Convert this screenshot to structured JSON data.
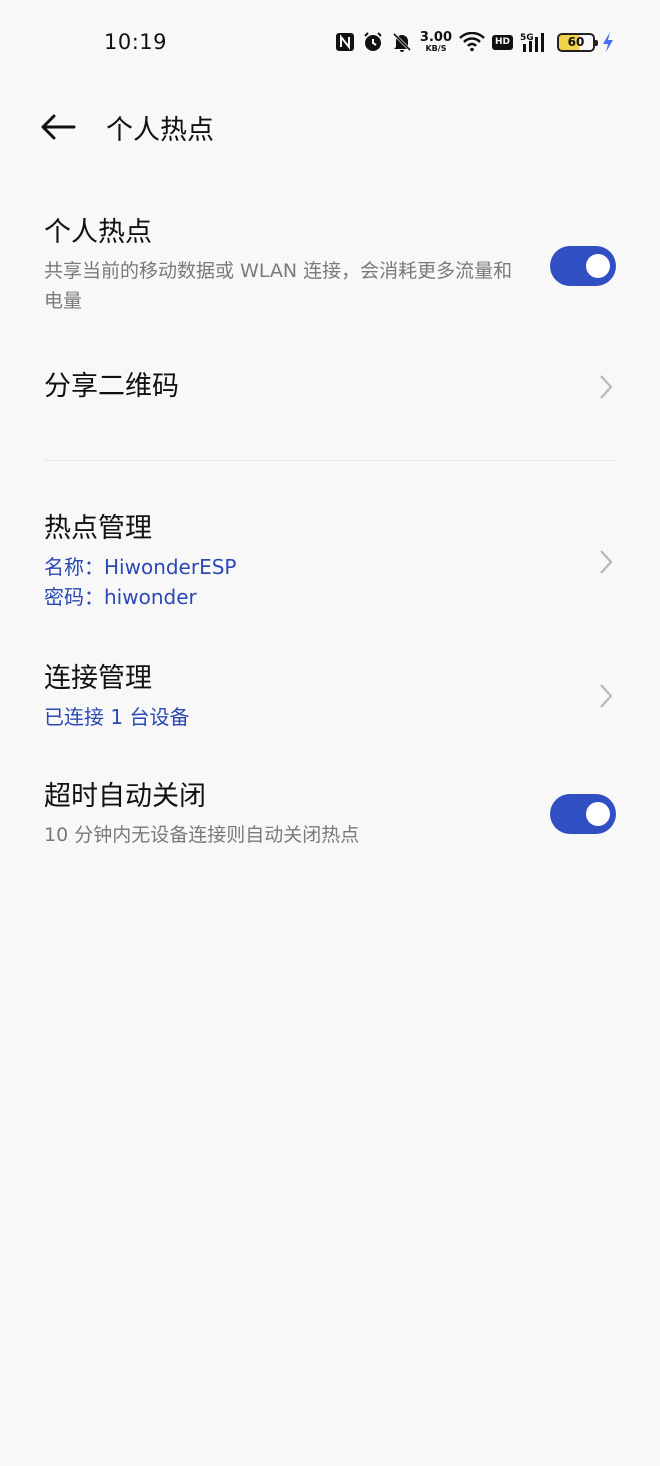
{
  "status_bar": {
    "time": "10:19",
    "icons": [
      "nfc-icon",
      "alarm-icon",
      "mute-icon",
      "wifi-icon",
      "hd-icon",
      "5g-signal-icon",
      "battery-icon",
      "charging-icon"
    ],
    "speed_value": "3.00",
    "speed_unit": "KB/S",
    "hd_label": "HD",
    "network_label": "5G",
    "battery_level": "60"
  },
  "header": {
    "title": "个人热点"
  },
  "hotspot": {
    "title": "个人热点",
    "description": "共享当前的移动数据或 WLAN 连接，会消耗更多流量和电量",
    "enabled": true
  },
  "share_qr": {
    "title": "分享二维码"
  },
  "hotspot_management": {
    "title": "热点管理",
    "name_line": "名称：HiwonderESP",
    "password_line": "密码：hiwonder"
  },
  "connection_management": {
    "title": "连接管理",
    "status": "已连接 1 台设备"
  },
  "auto_off": {
    "title": "超时自动关闭",
    "description": "10 分钟内无设备连接则自动关闭热点",
    "enabled": true
  },
  "colors": {
    "accent": "#2f4fc3",
    "link_text": "#2b49b3",
    "background": "#f8f8f8",
    "secondary_text": "#7a7a7a"
  }
}
